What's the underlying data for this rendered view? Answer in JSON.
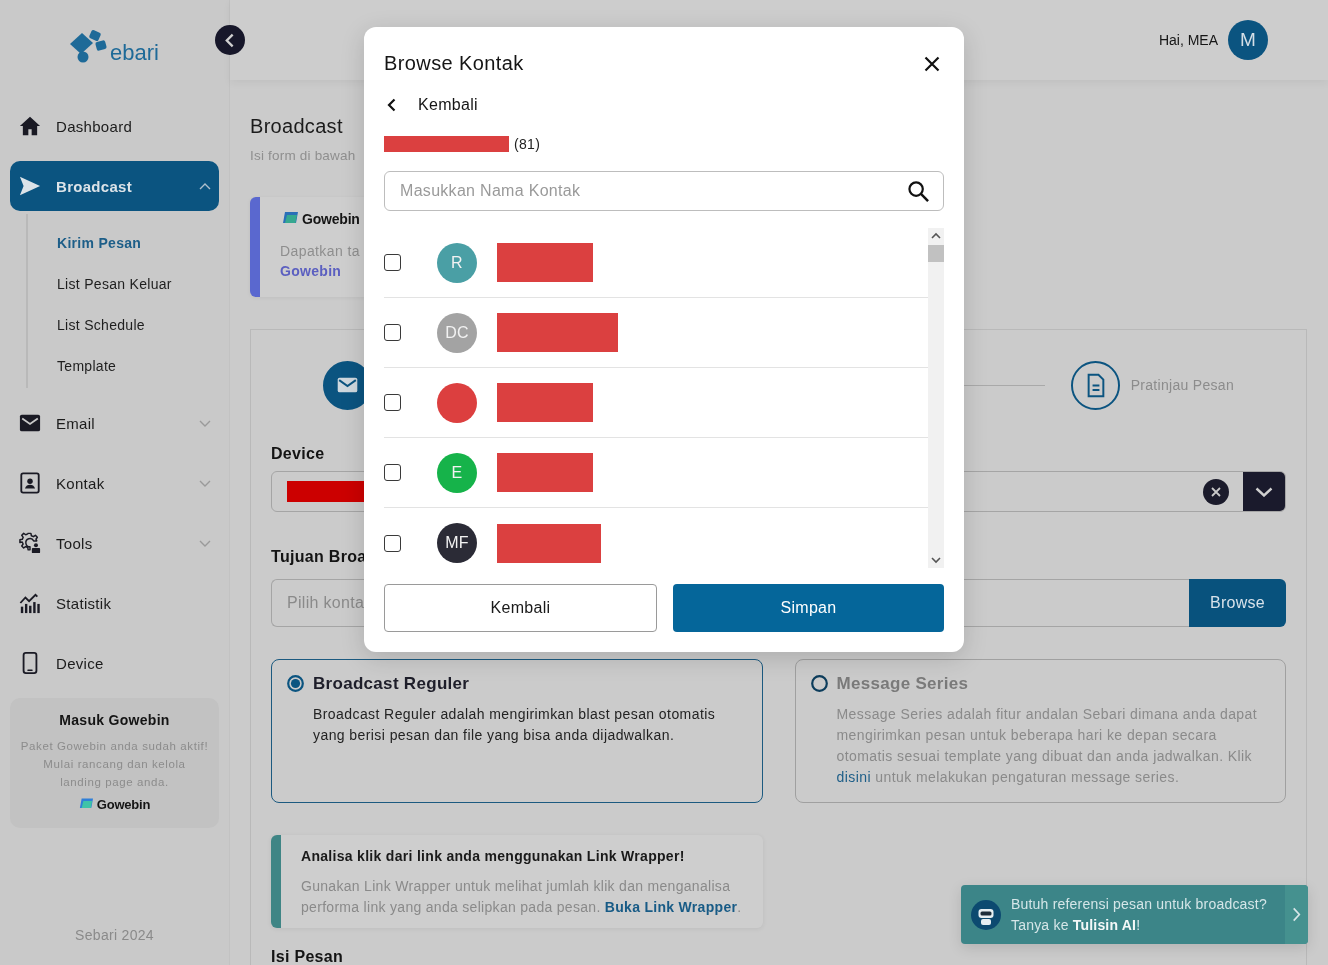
{
  "sidebar": {
    "logo_text": "ebari",
    "items": [
      {
        "label": "Dashboard",
        "kind": "link",
        "selected": false
      },
      {
        "label": "Broadcast",
        "kind": "group",
        "selected": true,
        "expanded": true,
        "children": [
          {
            "label": "Kirim Pesan",
            "selected": true
          },
          {
            "label": "List Pesan Keluar",
            "selected": false
          },
          {
            "label": "List Schedule",
            "selected": false
          },
          {
            "label": "Template",
            "selected": false
          }
        ]
      },
      {
        "label": "Email",
        "kind": "group",
        "selected": false,
        "expanded": false
      },
      {
        "label": "Kontak",
        "kind": "group",
        "selected": false,
        "expanded": false
      },
      {
        "label": "Tools",
        "kind": "group",
        "selected": false,
        "expanded": false
      },
      {
        "label": "Statistik",
        "kind": "link",
        "selected": false
      },
      {
        "label": "Device",
        "kind": "link",
        "selected": false
      }
    ],
    "promo": {
      "title": "Masuk Gowebin",
      "text_lines": [
        "Paket Gowebin anda sudah aktif!",
        "Mulai rancang dan kelola",
        "landing page anda."
      ],
      "brand": "Gowebin"
    },
    "footer": "Sebari 2024"
  },
  "header": {
    "greeting": "Hai, MEA",
    "avatar": "M"
  },
  "page": {
    "title": "Broadcast",
    "subtitle": "Isi form di bawah",
    "banner": {
      "brand": "Gowebin",
      "text": "Dapatkan ta",
      "link": "Gowebin"
    },
    "steps": [
      {
        "active": true
      },
      {
        "label": "Pratinjau Pesan",
        "active": false
      }
    ],
    "device_field": {
      "label": "Device"
    },
    "recipient_field": {
      "label": "Tujuan Broa",
      "placeholder": "Pilih konta",
      "button": "Browse"
    },
    "broadcast_types": [
      {
        "title": "Broadcast Reguler",
        "description": "Broadcast Reguler adalah mengirimkan blast pesan otomatis yang berisi pesan dan file yang bisa anda dijadwalkan.",
        "selected": true
      },
      {
        "title": "Message Series",
        "description": "Message Series adalah fitur andalan Sebari dimana anda dapat mengirimkan pesan untuk beberapa hari ke depan secara otomatis sesuai template yang dibuat dan anda jadwalkan. Klik",
        "link": "disini",
        "description_end": "untuk melakukan pengaturan message series.",
        "selected": false
      }
    ],
    "link_wrapper": {
      "title": "Analisa klik dari link anda menggunakan Link Wrapper!",
      "text": "Gunakan Link Wrapper untuk melihat jumlah klik dan menganalisa performa link yang anda selipkan pada pesan.",
      "link": "Buka Link Wrapper",
      "text_end": "."
    },
    "message_label": "Isi Pesan"
  },
  "assistant_prompt": {
    "lines": [
      "Butuh referensi pesan untuk broadcast?",
      "Tanya ke **Tulisin AI**!"
    ]
  },
  "modal": {
    "title": "Browse Kontak",
    "back_label": "Kembali",
    "group_count": "(81)",
    "search_placeholder": "Masukkan Nama Kontak",
    "contacts": [
      {
        "initials": "R",
        "color": "#4a9fa5",
        "checked": false
      },
      {
        "initials": "DC",
        "color": "#a3a3a3",
        "checked": false
      },
      {
        "color": "#dc3f3f",
        "checked": false
      },
      {
        "initials": "E",
        "color": "#16b34a",
        "checked": false
      },
      {
        "initials": "MF",
        "color": "#2b2b36",
        "checked": false
      }
    ],
    "buttons": [
      {
        "label": "Kembali",
        "kind": "secondary"
      },
      {
        "label": "Simpan",
        "kind": "primary"
      }
    ]
  }
}
